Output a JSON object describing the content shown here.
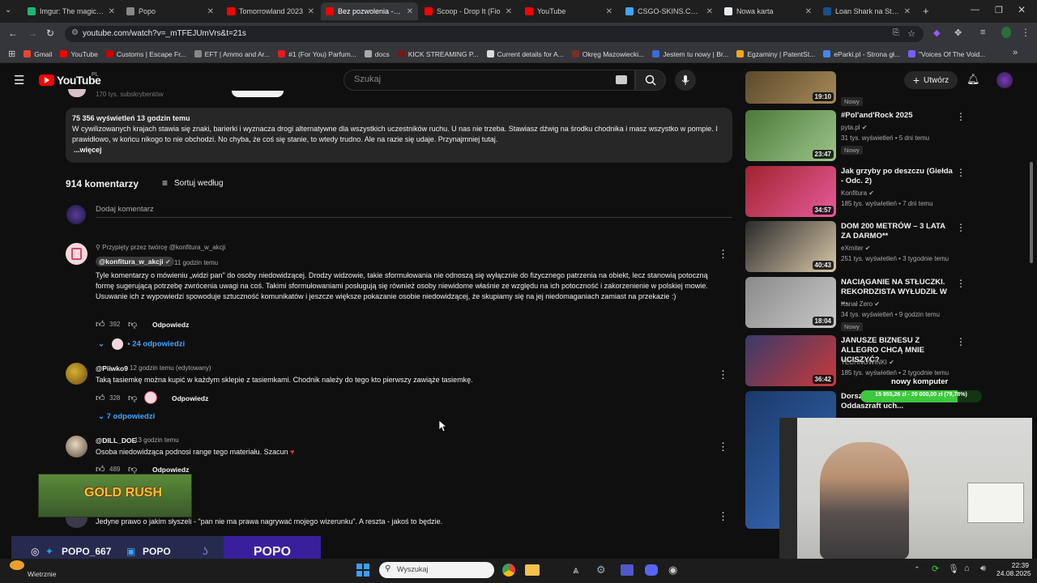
{
  "browser": {
    "tabs": [
      {
        "label": "Imgur: The magic of t",
        "color": "#1bb76e"
      },
      {
        "label": "Popo",
        "color": "#888888"
      },
      {
        "label": "Tomorrowland 2023",
        "color": "#ff0000"
      },
      {
        "label": "Bez pozwolenia - You",
        "color": "#ff0000"
      },
      {
        "label": "Scoop - Drop It (Fio",
        "color": "#ff0000"
      },
      {
        "label": "YouTube",
        "color": "#ff0000"
      },
      {
        "label": "CSGO-SKINS.COM -",
        "color": "#3ea6ff"
      },
      {
        "label": "Nowa karta",
        "color": "#e8eaed"
      },
      {
        "label": "Loan Shark na Steam",
        "color": "#1b4f8a"
      }
    ],
    "url": "youtube.com/watch?v=_mTFEJUmVrs&t=21s",
    "bookmarks": [
      {
        "label": "Gmail",
        "color": "#ea4335"
      },
      {
        "label": "YouTube",
        "color": "#ff0000"
      },
      {
        "label": "Customs | Escape Fr...",
        "color": "#cc0000"
      },
      {
        "label": "EFT | Ammo and Ar...",
        "color": "#888888"
      },
      {
        "label": "#1 (For You) Parfum...",
        "color": "#e31b23"
      },
      {
        "label": "docs",
        "color": "#aaaaaa"
      },
      {
        "label": "KICK STREAMING P...",
        "color": "#6a1b1b"
      },
      {
        "label": "Current details for A...",
        "color": "#dddddd"
      },
      {
        "label": "Okręg Mazowiecki...",
        "color": "#7b2d26"
      },
      {
        "label": "Jestem tu nowy | Br...",
        "color": "#3b6bd6"
      },
      {
        "label": "Egzaminy | PatentSt...",
        "color": "#f5a623"
      },
      {
        "label": "eParki.pl - Strona gł...",
        "color": "#4285f4"
      },
      {
        "label": "\"Voices Of The Void...",
        "color": "#7a5cff"
      }
    ]
  },
  "yt": {
    "logo": "YouTube",
    "region": "PL",
    "search_placeholder": "Szukaj",
    "create_label": "Utwórz"
  },
  "video": {
    "subs_cut": "170 tys. subskrybentów",
    "views_line": "75 356 wyświetleń  13 godzin temu",
    "description": "W cywilizowanych krajach stawia się znaki, barierki i wyznacza drogi alternatywne dla wszystkich uczestników ruchu. U nas nie trzeba. Stawiasz dźwig na środku chodnika i masz wszystko w pompie. I prawidłowo, w końcu nikogo to nie obchodzi. No chyba, że coś się stanie, to wtedy trudno. Ale na razie się udaje. Przynajmniej tutaj.",
    "more": "...więcej"
  },
  "comments_header": {
    "count": "914 komentarzy",
    "sort": "Sortuj według",
    "add": "Dodaj komentarz"
  },
  "comments": [
    {
      "pinned": "Przypięty przez twórcę @konfitura_w_akcji",
      "author": "@konfitura_w_akcji",
      "time": "11 godzin temu",
      "text": "Tyle komentarzy o mówieniu „widzi pan\" do osoby niedowidzącej. Drodzy widzowie, takie sformułowania nie odnoszą się wyłącznie do fizycznego patrzenia na obiekt, lecz stanowią potoczną formę sugerującą potrzebę zwrócenia uwagi na coś. Takimi sformułowaniami posługują się również osoby niewidome właśnie ze względu na ich potoczność i zakorzenienie w polskiej mowie. Usuwanie ich z wypowiedzi spowoduje sztuczność komunikatów i jeszcze większe pokazanie osobie niedowidzącej, że skupiamy się na jej niedomaganiach zamiast na przekazie :)",
      "likes": "392",
      "reply": "Odpowiedz",
      "replies": "24 odpowiedzi"
    },
    {
      "author": "@Piiwko9",
      "time": "12 godzin temu (edytowany)",
      "text": "Taką tasiemkę można kupić w każdym sklepie z tasiemkami.  Chodnik należy do tego kto pierwszy zawiąże tasiemkę.",
      "likes": "328",
      "reply": "Odpowiedz",
      "replies": "7 odpowiedzi"
    },
    {
      "author": "@DILL_DOE",
      "time": "13 godzin temu",
      "text": "Osoba niedowidząca podnosi range tego materiału. Szacun",
      "likes": "489",
      "reply": "Odpowiedz"
    },
    {
      "text": "Jedyne prawo o jakim słyszeli - \"pan nie ma prawa nagrywać mojego wizerunku\". A reszta - jakoś to będzie."
    }
  ],
  "sidebar": [
    {
      "title": "",
      "channel": "",
      "stats": "",
      "duration": "19:10",
      "badge": "Nowy",
      "colors": [
        "#5a4a2a",
        "#a88a5a"
      ]
    },
    {
      "title": "#Pol'and'Rock 2025",
      "channel": "pyta.pl",
      "stats": "31 tys. wyświetleń • 5 dni temu",
      "duration": "23:47",
      "badge": "Nowy",
      "colors": [
        "#4a7a3a",
        "#9ec48a"
      ]
    },
    {
      "title": "Jak grzyby po deszczu (Giełda - Odc. 2)",
      "channel": "Konfitura",
      "stats": "185 tys. wyświetleń • 7 dni temu",
      "duration": "34:57",
      "badge": "",
      "colors": [
        "#a0242e",
        "#e85a9b"
      ]
    },
    {
      "title": "DOM 200 METRÓW – 3 LATA ZA DARMO**",
      "channel": "eXmiter",
      "stats": "251 tys. wyświetleń • 3 tygodnie temu",
      "duration": "40:43",
      "badge": "",
      "colors": [
        "#2a2a2a",
        "#d8c8a8"
      ]
    },
    {
      "title": "NACIĄGANIE NA STŁUCZKI. REKORDZISTA WYŁUDZIŁ W ...",
      "channel": "Kanał Zero",
      "stats": "34 tys. wyświetleń • 9 godzin temu",
      "duration": "18:04",
      "badge": "Nowy",
      "colors": [
        "#8a8a8a",
        "#c8c8c8"
      ]
    },
    {
      "title": "JANUSZE BIZNESU Z ALLEGRO CHCĄ MNIE UCISZYĆ?",
      "channel": "TECHNOWINKI",
      "stats": "185 tys. wyświetleń • 2 tygodnie temu",
      "duration": "36:42",
      "badge": "",
      "colors": [
        "#3a3a6a",
        "#c83a3a"
      ]
    },
    {
      "title": "Dorsz... rybnej sciemy / Oddaszraft uch...",
      "channel": "",
      "stats": "",
      "duration": "",
      "badge": "",
      "colors": [
        "#1a3a6a",
        "#3a6ab8"
      ]
    }
  ],
  "overlays": {
    "goal_label": "nowy komputer",
    "goal_progress": "15 955,26 zł - 20 000,00 zł (79,78%)",
    "goal_fraction": 0.7978,
    "gold_rush": "GOLD RUSH",
    "social_handle": "POPO_667",
    "yt_handle": "POPO",
    "brand": "POPO"
  },
  "taskbar": {
    "weather": "Wietrznie",
    "search": "Wyszukaj",
    "time": "22:39",
    "date": "24.08.2025"
  }
}
